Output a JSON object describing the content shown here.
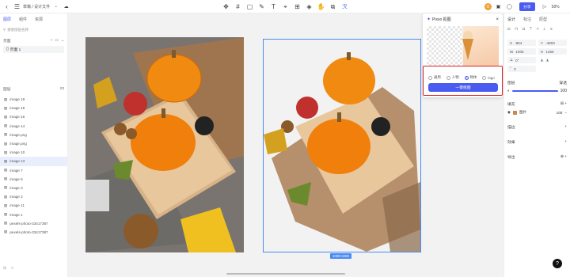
{
  "topbar": {
    "breadcrumb": "草稿 / 设计文件",
    "share_label": "分享",
    "zoom": "58%",
    "avatar_letter": "O"
  },
  "left": {
    "tabs": [
      {
        "label": "图层"
      },
      {
        "label": "组件"
      },
      {
        "label": "资源"
      }
    ],
    "search_placeholder": "搜索图层名称",
    "pages_label": "页面",
    "page_item": "页面 1",
    "layers_label": "图层",
    "layers_count": "23",
    "layers": [
      {
        "label": "image 19"
      },
      {
        "label": "image 18"
      },
      {
        "label": "image 16"
      },
      {
        "label": "image 14"
      },
      {
        "label": "image.png"
      },
      {
        "label": "image.png"
      },
      {
        "label": "image 10"
      },
      {
        "label": "image 13",
        "selected": true
      },
      {
        "label": "image 7"
      },
      {
        "label": "image 6"
      },
      {
        "label": "image 3"
      },
      {
        "label": "image 2"
      },
      {
        "label": "image 11"
      },
      {
        "label": "image 1"
      },
      {
        "label": "pexels-photo-33417387"
      },
      {
        "label": "pexels-photo-33417387"
      }
    ]
  },
  "canvas": {
    "size_badge": "1080×1080"
  },
  "plugin": {
    "title": "Pixso 抠图",
    "options": [
      {
        "label": "通用",
        "selected": false
      },
      {
        "label": "人物",
        "selected": false
      },
      {
        "label": "物体",
        "selected": true
      },
      {
        "label": "logo",
        "selected": false
      }
    ],
    "button_label": "一键抠图"
  },
  "right": {
    "tabs": [
      {
        "label": "设计"
      },
      {
        "label": "标注"
      },
      {
        "label": "原型"
      }
    ],
    "x": "-864",
    "y": "-4803",
    "w": "1005",
    "h": "1369",
    "rotation": "0°",
    "radius": "0",
    "layer_label": "图层",
    "blend": "穿透",
    "opacity": "100",
    "fill_label": "填充",
    "fill_type": "图片",
    "fill_opacity": "100",
    "stroke_label": "描边",
    "effect_label": "效果",
    "export_label": "导出"
  },
  "colors": {
    "accent": "#4a5cf0",
    "selection": "#4a8af4",
    "highlight": "#e02020"
  }
}
